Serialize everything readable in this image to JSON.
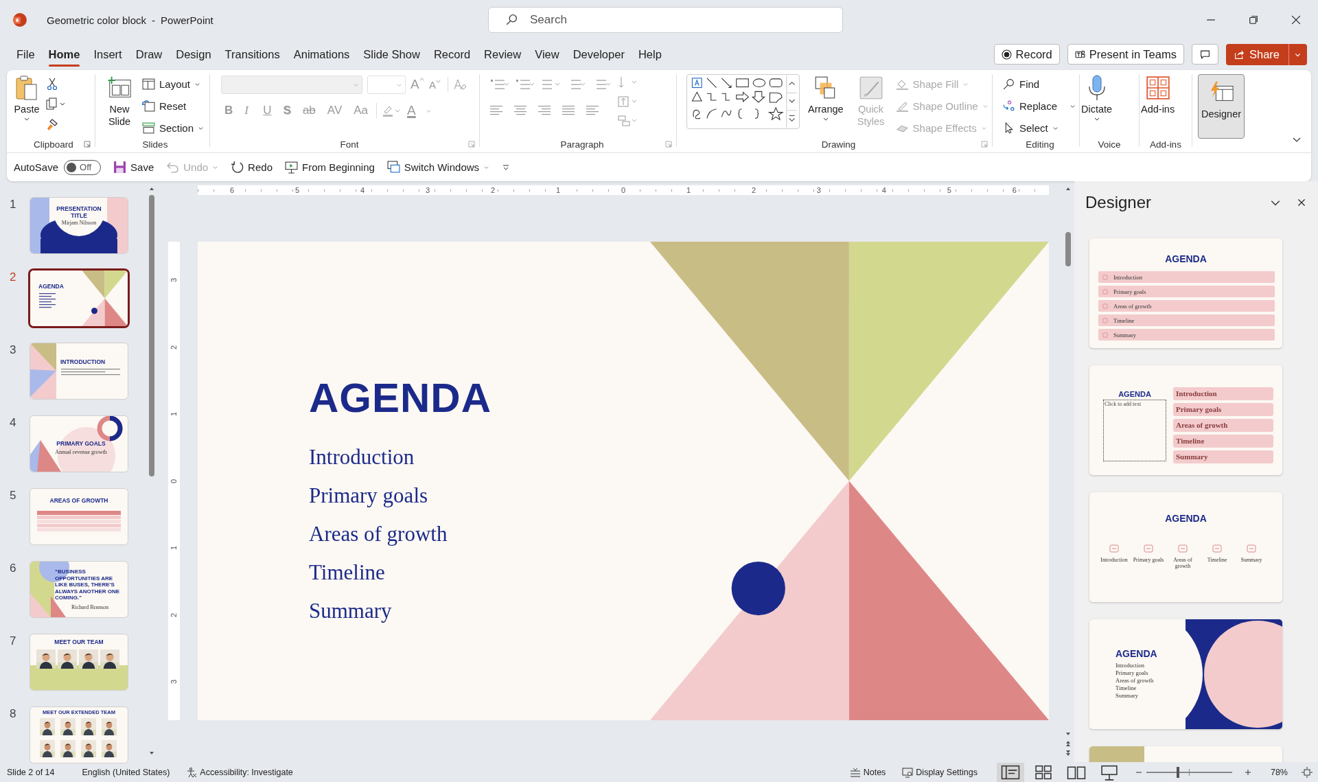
{
  "title_bar": {
    "document": "Geometric color block",
    "separator": "-",
    "app": "PowerPoint",
    "search_placeholder": "Search"
  },
  "menu": [
    {
      "label": "File",
      "selected": false
    },
    {
      "label": "Home",
      "selected": true
    },
    {
      "label": "Insert",
      "selected": false
    },
    {
      "label": "Draw",
      "selected": false
    },
    {
      "label": "Design",
      "selected": false
    },
    {
      "label": "Transitions",
      "selected": false
    },
    {
      "label": "Animations",
      "selected": false
    },
    {
      "label": "Slide Show",
      "selected": false
    },
    {
      "label": "Record",
      "selected": false
    },
    {
      "label": "Review",
      "selected": false
    },
    {
      "label": "View",
      "selected": false
    },
    {
      "label": "Developer",
      "selected": false
    },
    {
      "label": "Help",
      "selected": false
    }
  ],
  "header_actions": [
    {
      "kind": "record",
      "label": "Record"
    },
    {
      "kind": "teams",
      "label": "Present in Teams"
    },
    {
      "kind": "comments"
    },
    {
      "kind": "share",
      "label": "Share"
    }
  ],
  "ribbon": {
    "clipboard": {
      "label": "Clipboard",
      "paste": "Paste"
    },
    "slides": {
      "label": "Slides",
      "new_slide": "New Slide",
      "commands": [
        {
          "kind": "layout",
          "label": "Layout"
        },
        {
          "kind": "reset",
          "label": "Reset"
        },
        {
          "kind": "section",
          "label": "Section"
        }
      ]
    },
    "font": {
      "label": "Font",
      "disabled": true,
      "grow": "A",
      "shrink": "A",
      "styles": [
        {
          "kind": "bold",
          "glyph": "B"
        },
        {
          "kind": "italic",
          "glyph": "I"
        },
        {
          "kind": "underline",
          "glyph": "U"
        },
        {
          "kind": "shadow",
          "glyph": "S"
        },
        {
          "kind": "strike",
          "glyph": "ab"
        },
        {
          "kind": "spacing",
          "glyph": "AV"
        },
        {
          "kind": "case",
          "glyph": "Aa"
        }
      ],
      "font_color": "A"
    },
    "paragraph": {
      "label": "Paragraph",
      "disabled": true
    },
    "drawing": {
      "label": "Drawing",
      "arrange": "Arrange",
      "quick_styles": {
        "label": "Quick Styles",
        "disabled": true
      },
      "shape_format": [
        {
          "kind": "fill",
          "label": "Shape Fill",
          "disabled": true
        },
        {
          "kind": "outline",
          "label": "Shape Outline",
          "disabled": true
        },
        {
          "kind": "effects",
          "label": "Shape Effects",
          "disabled": true
        }
      ]
    },
    "editing": {
      "label": "Editing",
      "commands": [
        {
          "kind": "find",
          "label": "Find"
        },
        {
          "kind": "replace",
          "label": "Replace"
        },
        {
          "kind": "select",
          "label": "Select"
        }
      ]
    },
    "voice": {
      "label": "Voice",
      "dictate": "Dictate"
    },
    "addins": {
      "label": "Add-ins",
      "button": "Add-ins"
    },
    "designer": {
      "label": "Designer",
      "selected": true
    }
  },
  "quick_access": {
    "autosave": {
      "label": "AutoSave",
      "on": false,
      "state": "Off"
    },
    "commands": [
      {
        "kind": "save",
        "label": "Save",
        "disabled": false
      },
      {
        "kind": "undo",
        "label": "Undo",
        "disabled": true
      },
      {
        "kind": "redo",
        "label": "Redo",
        "disabled": false
      },
      {
        "kind": "present",
        "label": "From Beginning",
        "disabled": false
      },
      {
        "kind": "windows",
        "label": "Switch Windows",
        "disabled": false
      }
    ]
  },
  "rulers": {
    "horizontal": [
      "6",
      "5",
      "4",
      "3",
      "2",
      "1",
      "0",
      "1",
      "2",
      "3",
      "4",
      "5",
      "6"
    ],
    "vertical": [
      "3",
      "2",
      "1",
      "0",
      "1",
      "2",
      "3"
    ]
  },
  "thumbnails": [
    {
      "number": "1",
      "selected": false,
      "kind": "title",
      "title": "PRESENTATION TITLE",
      "subtitle": "Mirjam Nilsson"
    },
    {
      "number": "2",
      "selected": true,
      "kind": "agenda",
      "title": "AGENDA"
    },
    {
      "number": "3",
      "selected": false,
      "kind": "section",
      "title": "INTRODUCTION"
    },
    {
      "number": "4",
      "selected": false,
      "kind": "goals",
      "title": "PRIMARY GOALS",
      "subtitle": "Annual revenue growth"
    },
    {
      "number": "5",
      "selected": false,
      "kind": "table",
      "title": "AREAS OF GROWTH"
    },
    {
      "number": "6",
      "selected": false,
      "kind": "quote",
      "title": "“BUSINESS OPPORTUNITIES ARE LIKE BUSES, THERE'S ALWAYS ANOTHER ONE COMING.”",
      "subtitle": "Richard Branson"
    },
    {
      "number": "7",
      "selected": false,
      "kind": "team",
      "title": "MEET OUR TEAM"
    },
    {
      "number": "8",
      "selected": false,
      "kind": "team_grid",
      "title": "MEET OUR EXTENDED TEAM"
    }
  ],
  "slide": {
    "title": "AGENDA",
    "items": [
      "Introduction",
      "Primary goals",
      "Areas of growth",
      "Timeline",
      "Summary"
    ]
  },
  "designer_pane": {
    "title": "Designer",
    "ideas": [
      {
        "kind": "rows",
        "title": "AGENDA",
        "items": [
          "Introduction",
          "Primary goals",
          "Areas of growth",
          "Timeline",
          "Summary"
        ]
      },
      {
        "kind": "boxes",
        "title": "AGENDA",
        "placeholder": "Click to add text",
        "items": [
          "Introduction",
          "Primary goals",
          "Areas of growth",
          "Timeline",
          "Summary"
        ]
      },
      {
        "kind": "icons",
        "title": "AGENDA",
        "items": [
          "Introduction",
          "Primary goals",
          "Areas of growth",
          "Timeline",
          "Summary"
        ]
      },
      {
        "kind": "circles",
        "title": "AGENDA",
        "items": [
          "Introduction",
          "Primary goals",
          "Areas of growth",
          "Timeline",
          "Summary"
        ]
      },
      {
        "kind": "partial"
      }
    ]
  },
  "status_bar": {
    "slide_position": "Slide 2 of 14",
    "language": "English (United States)",
    "accessibility": "Accessibility: Investigate",
    "notes": "Notes",
    "display_settings": "Display Settings",
    "views": [
      {
        "kind": "normal",
        "selected": true
      },
      {
        "kind": "sorter",
        "selected": false
      },
      {
        "kind": "reading",
        "selected": false
      },
      {
        "kind": "slideshow",
        "selected": false
      }
    ],
    "zoom": {
      "level": 0.37,
      "reading": "78%"
    }
  }
}
